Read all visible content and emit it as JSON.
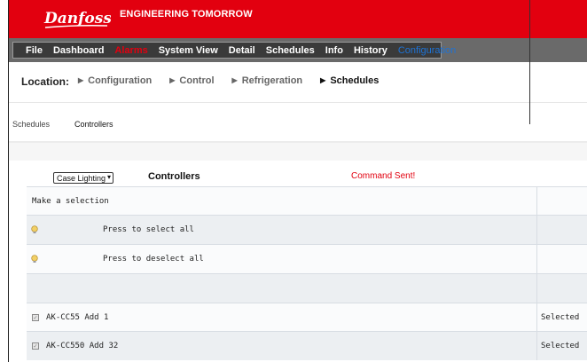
{
  "header": {
    "logo_text": "Danfoss",
    "tagline": "ENGINEERING TOMORROW"
  },
  "nav": {
    "items": [
      {
        "label": "File"
      },
      {
        "label": "Dashboard"
      },
      {
        "label": "Alarms"
      },
      {
        "label": "System View"
      },
      {
        "label": "Detail"
      },
      {
        "label": "Schedules"
      },
      {
        "label": "Info"
      },
      {
        "label": "History"
      },
      {
        "label": "Configuration"
      }
    ],
    "colors": {
      "alarm": "#e2000f",
      "active": "#1e73d6"
    }
  },
  "location": {
    "label": "Location:",
    "crumbs": [
      {
        "label": "Configuration"
      },
      {
        "label": "Control"
      },
      {
        "label": "Refrigeration"
      },
      {
        "label": "Schedules"
      }
    ]
  },
  "subtabs": [
    {
      "label": "Schedules"
    },
    {
      "label": "Controllers"
    }
  ],
  "toolbar": {
    "select_value": "Case Lighting",
    "title": "Controllers",
    "status": "Command Sent!"
  },
  "table": {
    "rows": [
      {
        "text": "Make a selection",
        "status": ""
      },
      {
        "text": "Press to select all",
        "status": ""
      },
      {
        "text": "Press to deselect all",
        "status": ""
      },
      {
        "text": "",
        "status": ""
      },
      {
        "text": "AK-CC55 Add 1",
        "status": "Selected"
      },
      {
        "text": "AK-CC550 Add 32",
        "status": "Selected"
      }
    ]
  }
}
